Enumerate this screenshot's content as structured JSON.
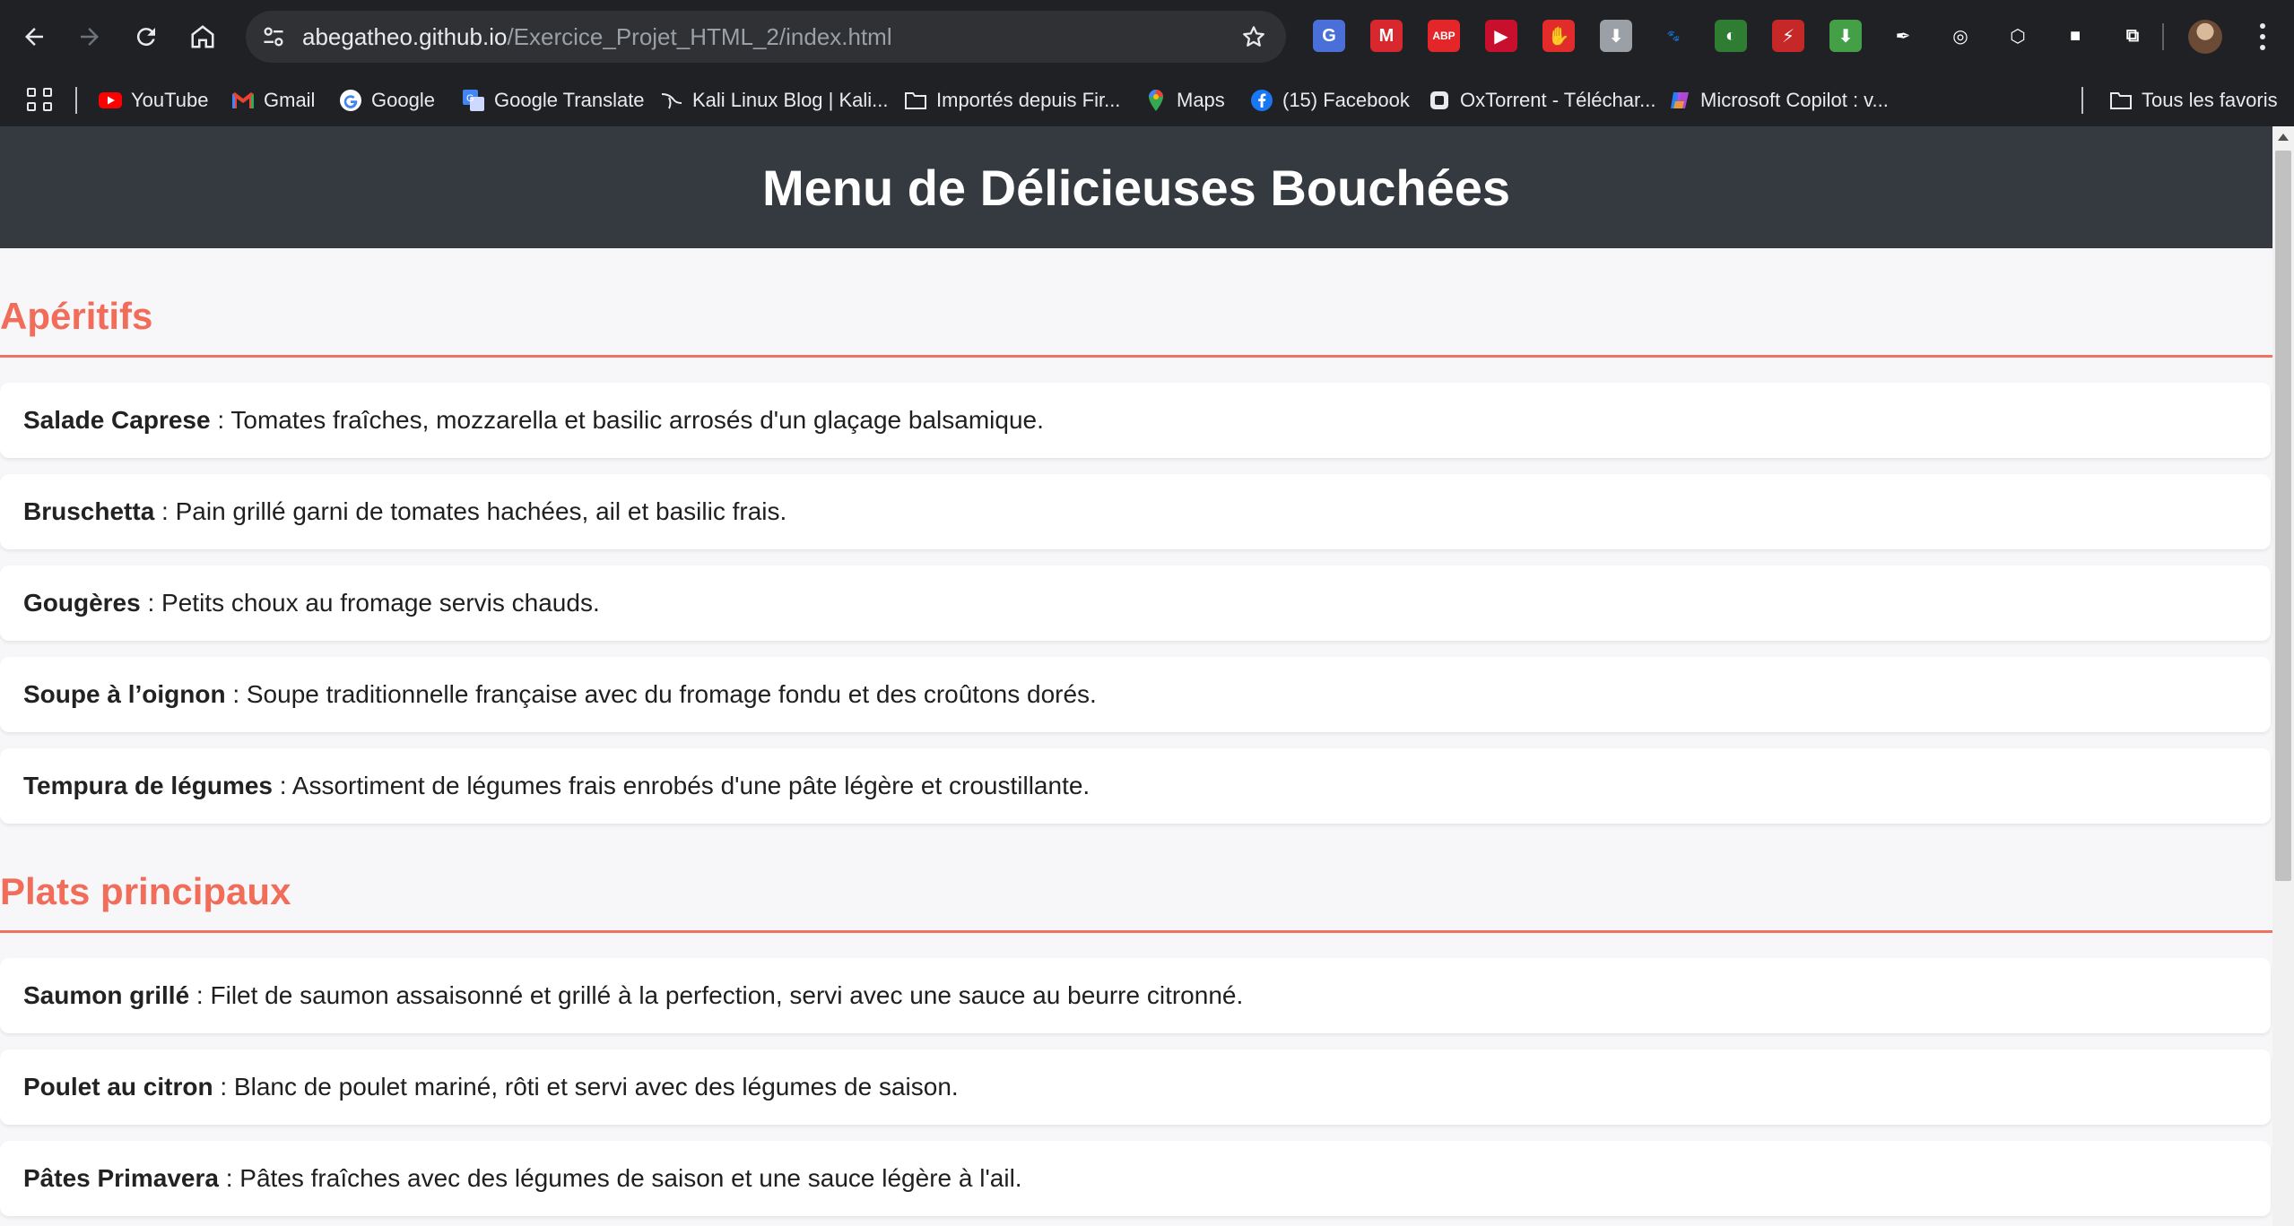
{
  "browser": {
    "url_domain": "abegatheo.github.io",
    "url_path": "/Exercice_Projet_HTML_2/index.html",
    "extensions": [
      {
        "name": "google-translate-extension-icon",
        "color": "#4a6fd8",
        "glyph": "G"
      },
      {
        "name": "mega-extension-icon",
        "color": "#d9272e",
        "glyph": "M"
      },
      {
        "name": "adblock-plus-extension-icon",
        "color": "#e4262a",
        "glyph": "ABP"
      },
      {
        "name": "video-downloader-extension-icon",
        "color": "#c8102e",
        "glyph": "▶"
      },
      {
        "name": "adblock-hand-extension-icon",
        "color": "#e22b2b",
        "glyph": "✋"
      },
      {
        "name": "download-extension-icon",
        "color": "#9aa0a6",
        "glyph": "⬇"
      },
      {
        "name": "gnome-extension-icon",
        "color": "#202124",
        "glyph": "🐾"
      },
      {
        "name": "color-extension-icon",
        "color": "#2e7d32",
        "glyph": "◐"
      },
      {
        "name": "pdf-extension-icon",
        "color": "#c62828",
        "glyph": "⚡"
      },
      {
        "name": "green-download-extension-icon",
        "color": "#43a047",
        "glyph": "⬇"
      },
      {
        "name": "eyedropper-extension-icon",
        "color": "#202124",
        "glyph": "✒"
      },
      {
        "name": "colorzilla-extension-icon",
        "color": "#202124",
        "glyph": "◎"
      },
      {
        "name": "cube-extension-icon",
        "color": "#202124",
        "glyph": "⬡"
      },
      {
        "name": "pinned-extension-icon",
        "color": "#202124",
        "glyph": "■"
      },
      {
        "name": "extensions-puzzle-icon",
        "color": "#202124",
        "glyph": "⧉"
      }
    ]
  },
  "bookmarks": {
    "items": [
      {
        "label": "YouTube",
        "icon": "youtube-icon"
      },
      {
        "label": "Gmail",
        "icon": "gmail-icon"
      },
      {
        "label": "Google",
        "icon": "google-icon"
      },
      {
        "label": "Google Translate",
        "icon": "google-translate-icon"
      },
      {
        "label": "Kali Linux Blog | Kali...",
        "icon": "kali-dragon-icon"
      },
      {
        "label": "Importés depuis Fir...",
        "icon": "folder-icon"
      },
      {
        "label": "Maps",
        "icon": "maps-pin-icon"
      },
      {
        "label": "(15) Facebook",
        "icon": "facebook-icon"
      },
      {
        "label": "OxTorrent - Téléchar...",
        "icon": "oxtorrent-icon"
      },
      {
        "label": "Microsoft Copilot : v...",
        "icon": "copilot-icon"
      }
    ],
    "all_bookmarks_label": "Tous les favoris"
  },
  "page": {
    "title": "Menu de Délicieuses Bouchées",
    "colors": {
      "header_bg": "#343a40",
      "accent": "#f26c5a"
    },
    "sections": [
      {
        "title": "Apéritifs",
        "items": [
          {
            "name": "Salade Caprese",
            "desc": " : Tomates fraîches, mozzarella et basilic arrosés d'un glaçage balsamique."
          },
          {
            "name": "Bruschetta",
            "desc": " : Pain grillé garni de tomates hachées, ail et basilic frais."
          },
          {
            "name": "Gougères",
            "desc": " : Petits choux au fromage servis chauds."
          },
          {
            "name": "Soupe à l’oignon",
            "desc": " : Soupe traditionnelle française avec du fromage fondu et des croûtons dorés."
          },
          {
            "name": "Tempura de légumes",
            "desc": " : Assortiment de légumes frais enrobés d'une pâte légère et croustillante."
          }
        ]
      },
      {
        "title": "Plats principaux",
        "items": [
          {
            "name": "Saumon grillé",
            "desc": " : Filet de saumon assaisonné et grillé à la perfection, servi avec une sauce au beurre citronné."
          },
          {
            "name": "Poulet au citron",
            "desc": " : Blanc de poulet mariné, rôti et servi avec des légumes de saison."
          },
          {
            "name": "Pâtes Primavera",
            "desc": " : Pâtes fraîches avec des légumes de saison et une sauce légère à l'ail."
          }
        ]
      }
    ]
  }
}
